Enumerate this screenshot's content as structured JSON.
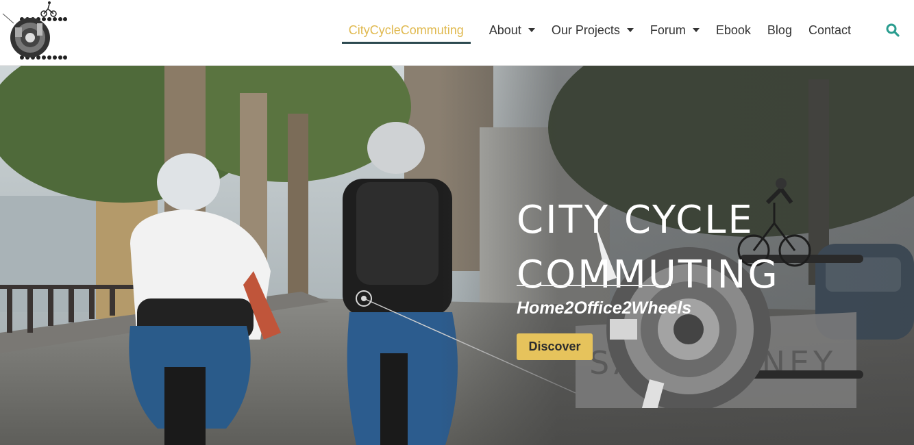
{
  "nav": {
    "items": [
      {
        "label": "CityCycleCommuting",
        "active": true,
        "dropdown": false
      },
      {
        "label": "About",
        "active": false,
        "dropdown": true
      },
      {
        "label": "Our Projects",
        "active": false,
        "dropdown": true
      },
      {
        "label": "Forum",
        "active": false,
        "dropdown": true
      },
      {
        "label": "Ebook",
        "active": false,
        "dropdown": false
      },
      {
        "label": "Blog",
        "active": false,
        "dropdown": false
      },
      {
        "label": "Contact",
        "active": false,
        "dropdown": false
      }
    ],
    "search_icon": "search-icon"
  },
  "hero": {
    "title_line1": "CITY CYCLE",
    "title_line2": "COMMUTING",
    "subtitle": "Home2Office2Wheels",
    "button_label": "Discover",
    "sign_text": "SAVE MONEY"
  },
  "colors": {
    "accent": "#e0b94f",
    "underline": "#2d4a50",
    "search": "#2a9d8f",
    "button": "#e6c35c"
  }
}
